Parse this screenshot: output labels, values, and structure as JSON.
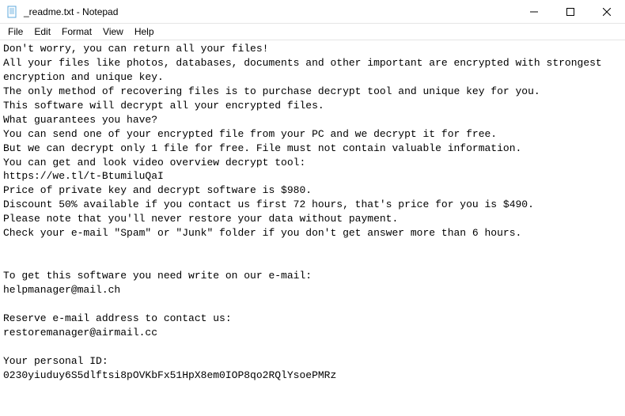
{
  "titlebar": {
    "title": "_readme.txt - Notepad"
  },
  "menubar": {
    "file": "File",
    "edit": "Edit",
    "format": "Format",
    "view": "View",
    "help": "Help"
  },
  "content": {
    "text": "Don't worry, you can return all your files!\nAll your files like photos, databases, documents and other important are encrypted with strongest encryption and unique key.\nThe only method of recovering files is to purchase decrypt tool and unique key for you.\nThis software will decrypt all your encrypted files.\nWhat guarantees you have?\nYou can send one of your encrypted file from your PC and we decrypt it for free.\nBut we can decrypt only 1 file for free. File must not contain valuable information.\nYou can get and look video overview decrypt tool:\nhttps://we.tl/t-BtumiluQaI\nPrice of private key and decrypt software is $980.\nDiscount 50% available if you contact us first 72 hours, that's price for you is $490.\nPlease note that you'll never restore your data without payment.\nCheck your e-mail \"Spam\" or \"Junk\" folder if you don't get answer more than 6 hours.\n\n\nTo get this software you need write on our e-mail:\nhelpmanager@mail.ch\n\nReserve e-mail address to contact us:\nrestoremanager@airmail.cc\n\nYour personal ID:\n0230yiuduy6S5dlftsi8pOVKbFx51HpX8em0IOP8qo2RQlYsoePMRz"
  }
}
